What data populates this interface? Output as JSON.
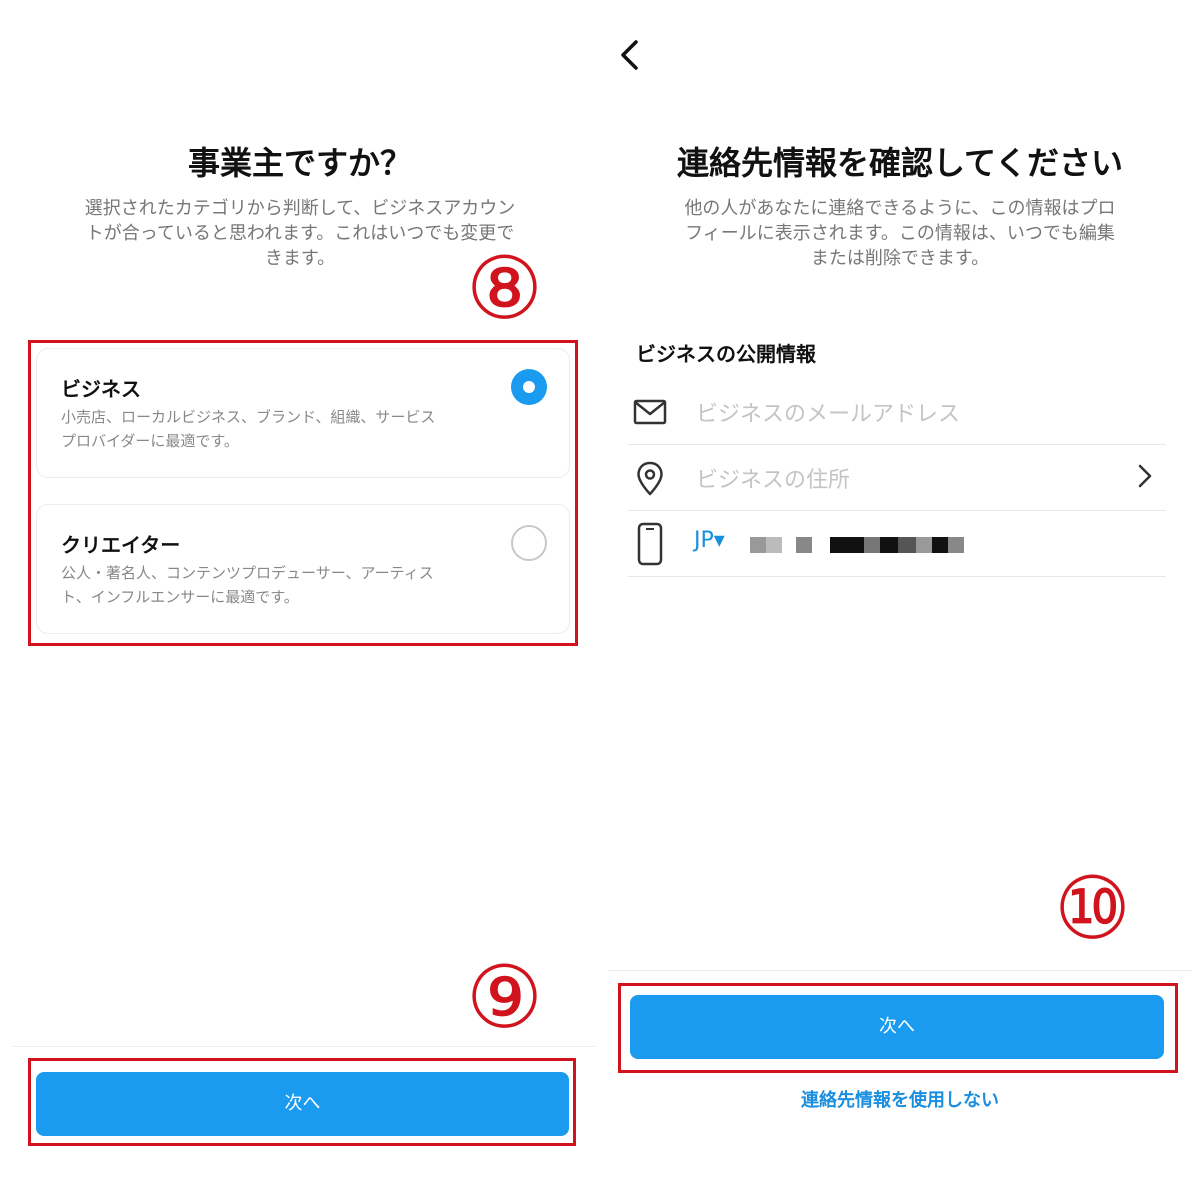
{
  "left": {
    "title": "事業主ですか？",
    "subtitle_lines": [
      "選択されたカテゴリから判断して、ビジネスアカウン",
      "トが合っていると思われます。これはいつでも変更で",
      "きます。"
    ],
    "step_top": "⑧",
    "step_bottom": "⑨",
    "options": [
      {
        "title": "ビジネス",
        "desc_lines": [
          "小売店、ローカルビジネス、ブランド、組織、サービス",
          "プロバイダーに最適です。"
        ],
        "selected": true
      },
      {
        "title": "クリエイター",
        "desc_lines": [
          "公人・著名人、コンテンツプロデューサー、アーティス",
          "ト、インフルエンサーに最適です。"
        ],
        "selected": false
      }
    ],
    "next_label": "次へ"
  },
  "right": {
    "title": "連絡先情報を確認してください",
    "subtitle_lines": [
      "他の人があなたに連絡できるように、この情報はプロ",
      "フィールに表示されます。この情報は、いつでも編集",
      "または削除できます。"
    ],
    "section_label": "ビジネスの公開情報",
    "email_placeholder": "ビジネスのメールアドレス",
    "address_placeholder": "ビジネスの住所",
    "country_code": "JP▾",
    "step": "⑩",
    "next_label": "次へ",
    "skip_label": "連絡先情報を使用しない"
  },
  "icons": {
    "back": "back-chevron-icon",
    "mail": "mail-icon",
    "location": "location-pin-icon",
    "phone": "phone-icon",
    "chevron": "chevron-right-icon"
  },
  "colors": {
    "accent": "#1a9bf0",
    "annotation_red": "#d0131c"
  }
}
